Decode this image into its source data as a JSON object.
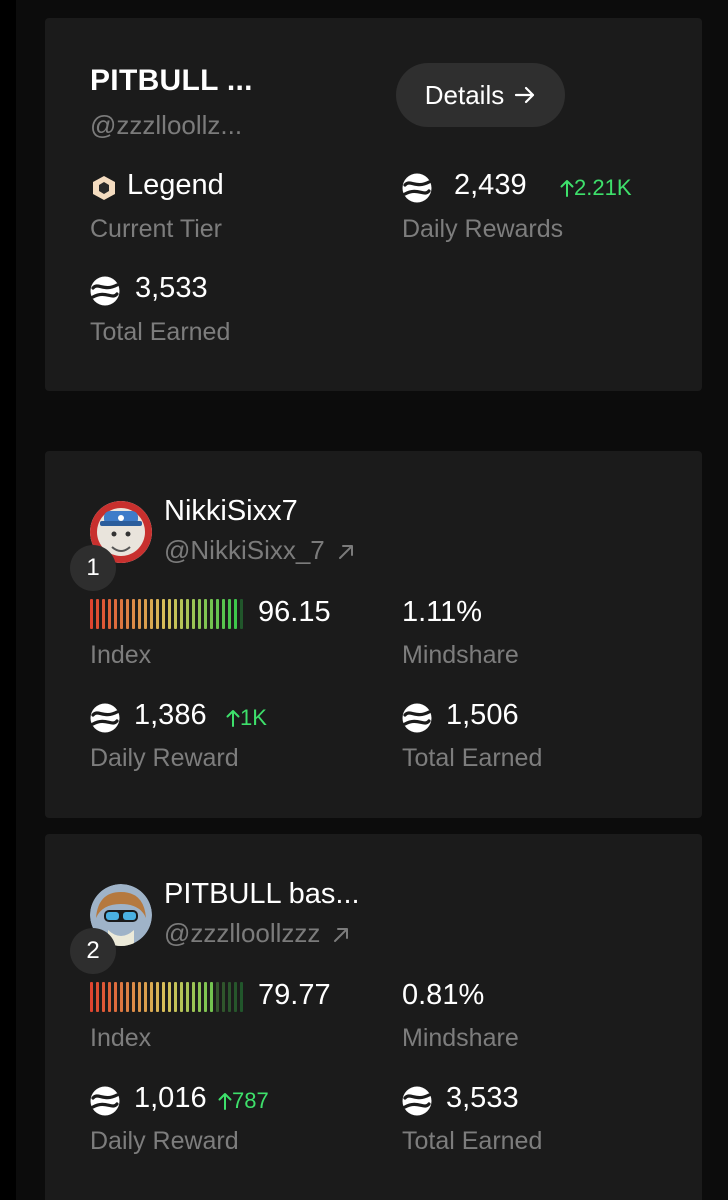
{
  "top_card": {
    "name": "PITBULL ...",
    "handle": "@zzzlloollz...",
    "details_label": "Details",
    "tier_value": "Legend",
    "tier_label": "Current Tier",
    "daily_value": "2,439",
    "daily_change": "2.21K",
    "daily_label": "Daily Rewards",
    "total_value": "3,533",
    "total_label": "Total Earned"
  },
  "leaderboard": [
    {
      "rank": "1",
      "name": "NikkiSixx7",
      "handle": "@NikkiSixx_7",
      "index_value": "96.15",
      "index_score": 96.15,
      "index_label": "Index",
      "mindshare_value": "1.11%",
      "mindshare_label": "Mindshare",
      "daily_value": "1,386",
      "daily_change": "1K",
      "daily_label": "Daily Reward",
      "total_value": "1,506",
      "total_label": "Total Earned"
    },
    {
      "rank": "2",
      "name": "PITBULL bas...",
      "handle": "@zzzlloollzzz",
      "index_value": "79.77",
      "index_score": 79.77,
      "index_label": "Index",
      "mindshare_value": "0.81%",
      "mindshare_label": "Mindshare",
      "daily_value": "1,016",
      "daily_change": "787",
      "daily_label": "Daily Reward",
      "total_value": "3,533",
      "total_label": "Total Earned"
    }
  ],
  "icons": {
    "tier": "hexagon-icon",
    "coin": "coin-icon",
    "up": "arrow-up-icon",
    "external": "external-link-icon",
    "details": "arrow-right-icon"
  },
  "colors": {
    "accent_up": "#3ee06b",
    "card_bg": "#1b1b1b",
    "muted": "#7d7d7d"
  }
}
